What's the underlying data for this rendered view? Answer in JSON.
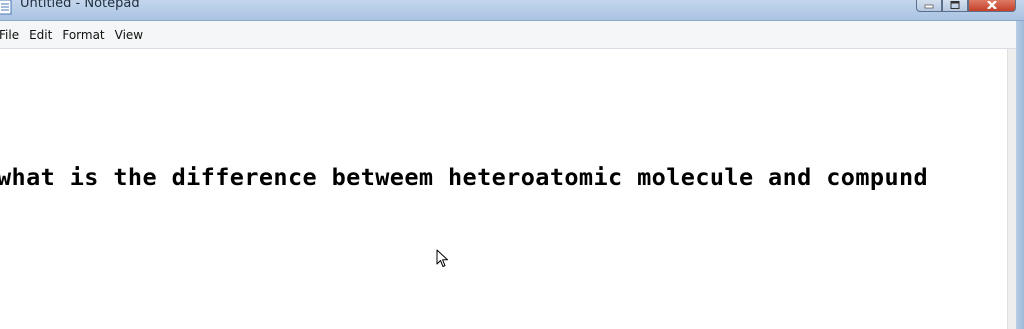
{
  "window": {
    "title": "Untitled - Notepad"
  },
  "menu": {
    "items": [
      "File",
      "Edit",
      "Format",
      "View"
    ]
  },
  "editor": {
    "text": "what is the difference betweem heteroatomic molecule and compund"
  },
  "icons": {
    "app": "notepad-icon",
    "minimize": "minimize-icon",
    "maximize": "maximize-icon",
    "close": "close-icon",
    "pointer": "mouse-pointer-icon"
  },
  "colors": {
    "titlebar": "#b3cbe6",
    "close_button": "#c6402a",
    "editor_bg": "#ffffff"
  }
}
